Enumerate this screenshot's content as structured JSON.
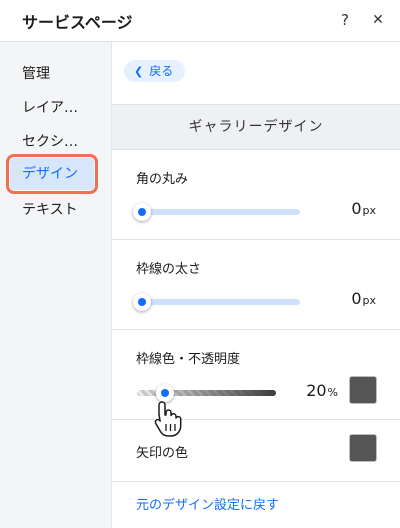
{
  "header": {
    "title": "サービスページ",
    "help_icon": "?",
    "close_icon": "✕"
  },
  "sidebar": {
    "items": [
      {
        "label": "管理"
      },
      {
        "label": "レイア…"
      },
      {
        "label": "セクシ…"
      },
      {
        "label": "デザイン"
      },
      {
        "label": "テキスト"
      }
    ],
    "selected_index": 3
  },
  "main": {
    "back_label": "戻る",
    "section_title": "ギャラリーデザイン",
    "corner_radius": {
      "label": "角の丸み",
      "value": "0",
      "unit": "px",
      "slider_level": 0
    },
    "border_width": {
      "label": "枠線の太さ",
      "value": "0",
      "unit": "px",
      "slider_level": 0
    },
    "border_color": {
      "label": "枠線色・不透明度",
      "value": "20",
      "unit": "%",
      "slider_level": 0.2,
      "swatch_color": "#555555"
    },
    "arrow_color": {
      "label": "矢印の色",
      "swatch_color": "#555555"
    },
    "reset_link": "元のデザイン設定に戻す"
  },
  "colors": {
    "accent": "#116dff",
    "selected_bg": "#d8e6fb",
    "highlight_outline": "#ef6f52"
  }
}
